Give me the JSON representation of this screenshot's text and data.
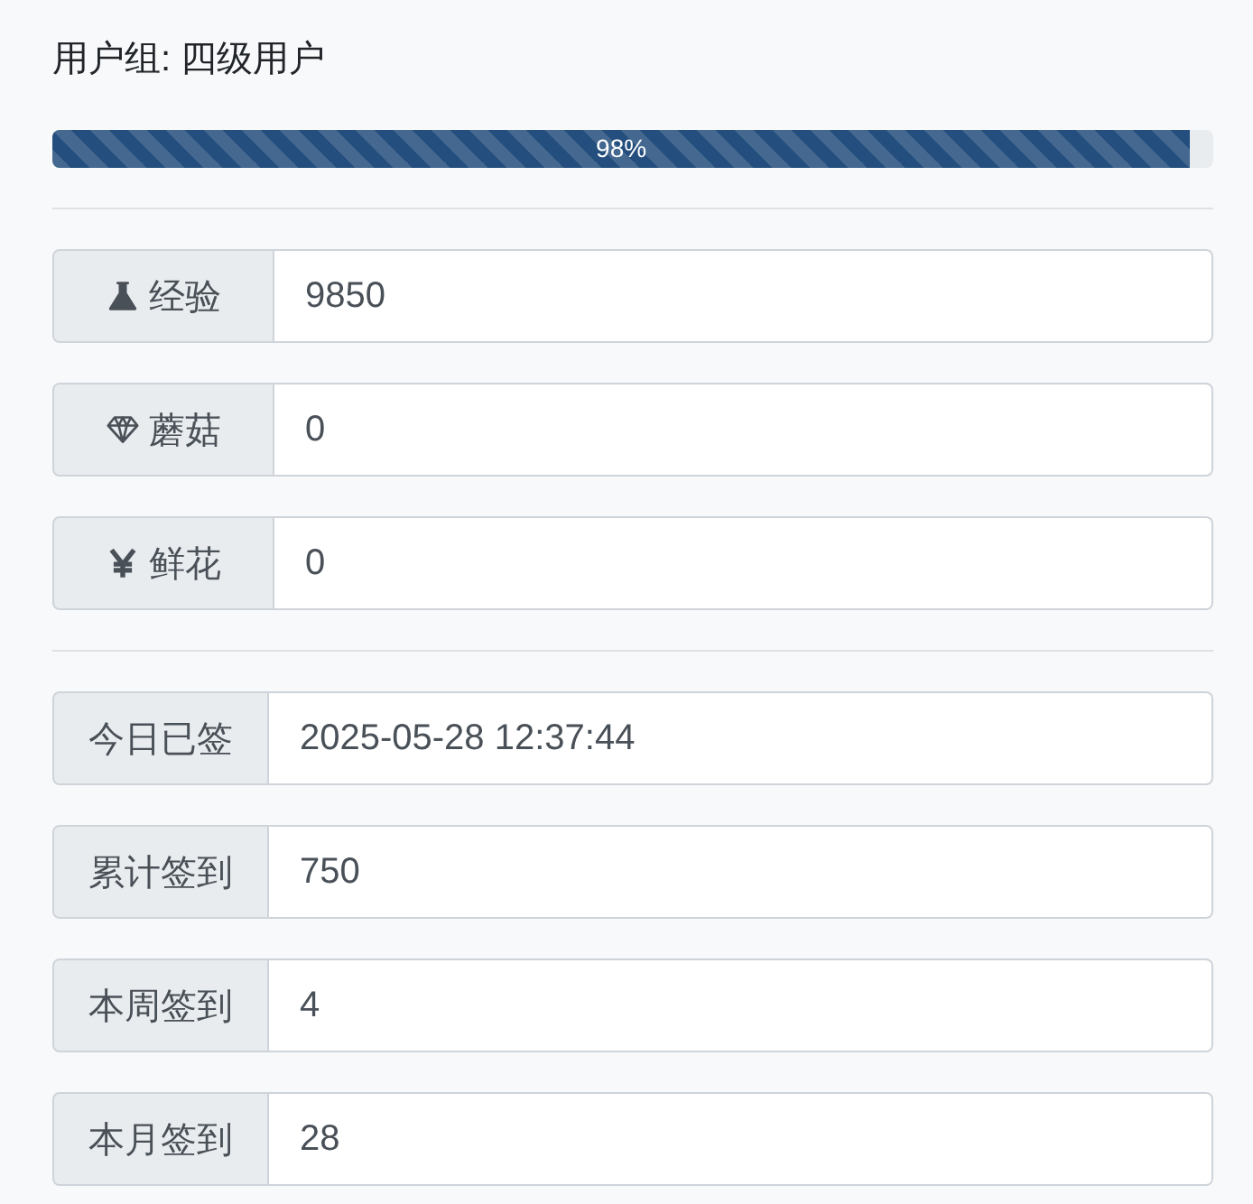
{
  "user_group": "用户组: 四级用户",
  "progress": {
    "level": 0.98,
    "label": "98%"
  },
  "assets": [
    {
      "kind": "flask",
      "label": "经验",
      "value": "9850"
    },
    {
      "kind": "gem",
      "label": "蘑菇",
      "value": "0"
    },
    {
      "kind": "yen",
      "label": "鲜花",
      "value": "0"
    }
  ],
  "checkins": [
    {
      "label": "今日已签",
      "value": "2025-05-28 12:37:44"
    },
    {
      "label": "累计签到",
      "value": "750"
    },
    {
      "label": "本周签到",
      "value": "4"
    },
    {
      "label": "本月签到",
      "value": "28"
    }
  ]
}
